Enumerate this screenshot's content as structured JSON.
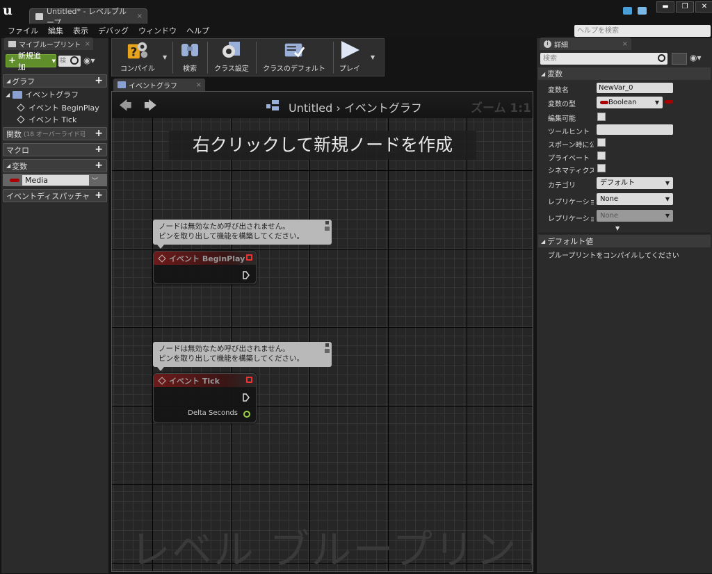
{
  "titlebar": {
    "tab_label": "Untitled* - レベルブループ",
    "close": "×"
  },
  "window_buttons": {
    "minimize": "▬",
    "maximize": "❐",
    "close": "✕"
  },
  "menu": [
    "ファイル",
    "編集",
    "表示",
    "デバッグ",
    "ウィンドウ",
    "ヘルプ"
  ],
  "help_search": {
    "placeholder": "ヘルプを検索"
  },
  "left_panel": {
    "tab": "マイブループリント",
    "add_new": "新規追加",
    "search_placeholder": "検",
    "sections": {
      "graph": "グラフ",
      "functions": "関数",
      "functions_note": "(18 オーバーライド可",
      "macros": "マクロ",
      "variables": "変数",
      "dispatchers": "イベントディスパッチャ"
    },
    "graph_tree": {
      "event_graph": "イベントグラフ",
      "begin_play": "イベント BeginPlay",
      "tick": "イベント Tick"
    },
    "variable": {
      "name": "Media"
    }
  },
  "toolbar": {
    "compile": "コンパイル",
    "search": "検索",
    "class_settings": "クラス設定",
    "class_defaults": "クラスのデフォルト",
    "play": "プレイ"
  },
  "graph": {
    "tab": "イベントグラフ",
    "breadcrumb_root": "Untitled",
    "breadcrumb_sep": "›",
    "breadcrumb_graph": "イベントグラフ",
    "zoom": "ズーム 1:1",
    "hint": "右クリックして新規ノードを作成",
    "comment_line1": "ノードは無効なため呼び出されません。",
    "comment_line2": "ピンを取り出して機能を構築してください。",
    "node1_title": "イベント BeginPlay",
    "node2_title": "イベント Tick",
    "delta_seconds": "Delta Seconds",
    "watermark": "レベル ブループリント"
  },
  "details": {
    "tab": "詳細",
    "search_placeholder": "検索",
    "section_variable": "変数",
    "labels": [
      "変数名",
      "変数の型",
      "編集可能",
      "ツールヒント",
      "スポーン時に公",
      "プライベート",
      "シネマティクス",
      "カテゴリ",
      "レプリケーショ",
      "レプリケーショ"
    ],
    "var_name": "NewVar_0",
    "var_type": "Boolean",
    "category": "デフォルト",
    "replication": "None",
    "replication_condition": "None",
    "section_default": "デフォルト値",
    "default_msg": "ブループリントをコンパイルしてください"
  },
  "colors": {
    "add_new": "#5f8e2b",
    "event_node": "#6e1a1a",
    "bool_pin": "#a00000"
  }
}
